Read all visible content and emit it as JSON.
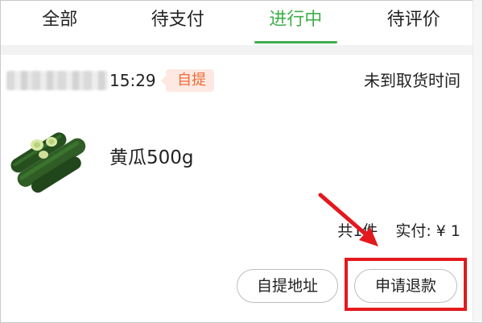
{
  "tabs": [
    {
      "label": "全部",
      "active": false
    },
    {
      "label": "待支付",
      "active": false
    },
    {
      "label": "进行中",
      "active": true
    },
    {
      "label": "待评价",
      "active": false
    }
  ],
  "order": {
    "time": "15:29",
    "pickup_badge": "自提",
    "status": "未到取货时间",
    "product": {
      "name": "黄瓜500g",
      "image_icon": "cucumber-image"
    },
    "quantity_text": "共1件",
    "paid_text": "实付: ¥ 1"
  },
  "actions": {
    "pickup_address_label": "自提地址",
    "refund_label": "申请退款"
  },
  "colors": {
    "accent": "#3fae4b",
    "badge_text": "#ef6a3a",
    "badge_bg": "#fde9e1",
    "annotation_red": "#e3191e"
  }
}
